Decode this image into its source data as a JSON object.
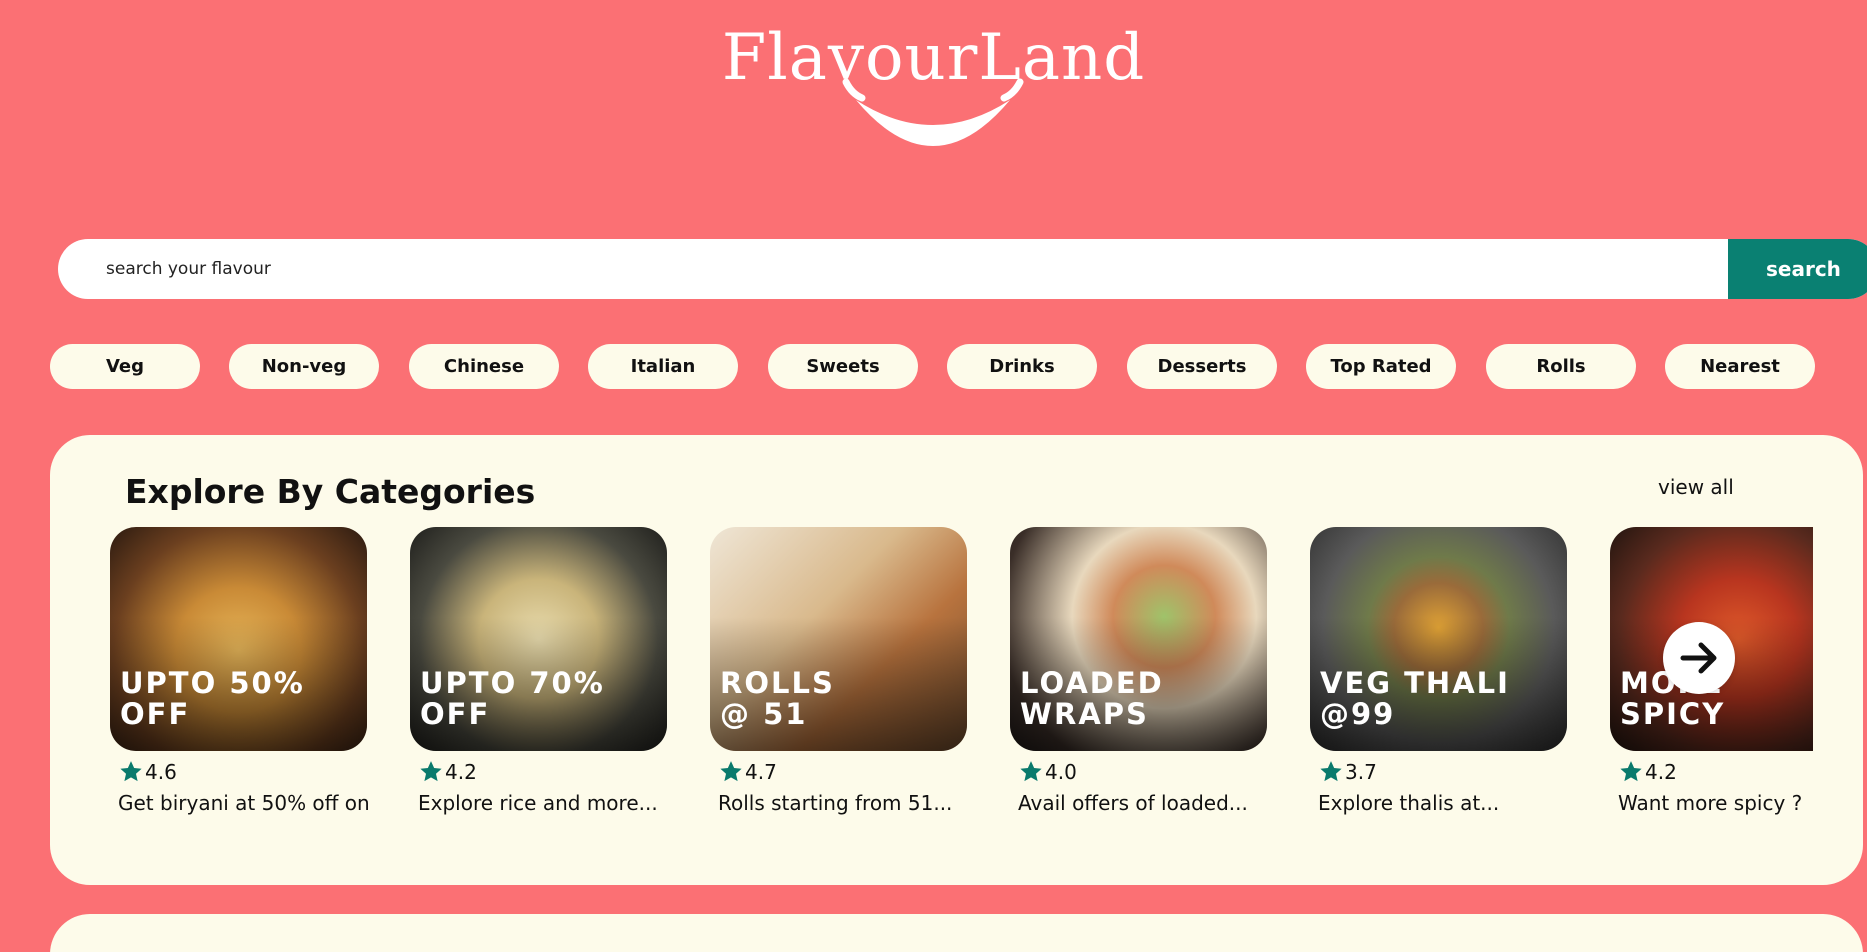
{
  "brand": {
    "name": "FlavourLand"
  },
  "search": {
    "placeholder": "search your flavour",
    "button_label": "search"
  },
  "filters": [
    "Veg",
    "Non-veg",
    "Chinese",
    "Italian",
    "Sweets",
    "Drinks",
    "Desserts",
    "Top Rated",
    "Rolls",
    "Nearest"
  ],
  "categories": {
    "title": "Explore By Categories",
    "view_all_label": "view all",
    "cards": [
      {
        "tag": "UPTO 50%\nOFF",
        "rating": "4.6",
        "description": "Get biryani at 50% off on..."
      },
      {
        "tag": "UPTO 70%\nOFF",
        "rating": "4.2",
        "description": "Explore rice and more..."
      },
      {
        "tag": "ROLLS\n@ 51",
        "rating": "4.7",
        "description": "Rolls starting from 51..."
      },
      {
        "tag": "LOADED\nWRAPS",
        "rating": "4.0",
        "description": "Avail offers of loaded..."
      },
      {
        "tag": "VEG THALI\n@99",
        "rating": "3.7",
        "description": "Explore thalis at..."
      },
      {
        "tag": "MORE\nSPICY",
        "rating": "4.2",
        "description": "Want more spicy ?"
      }
    ]
  },
  "colors": {
    "background": "#fb7074",
    "panel": "#fdfbea",
    "accent": "#0a8072"
  },
  "icons": {
    "rating": "star-icon",
    "next": "arrow-right-icon",
    "logo": "smile-icon"
  }
}
